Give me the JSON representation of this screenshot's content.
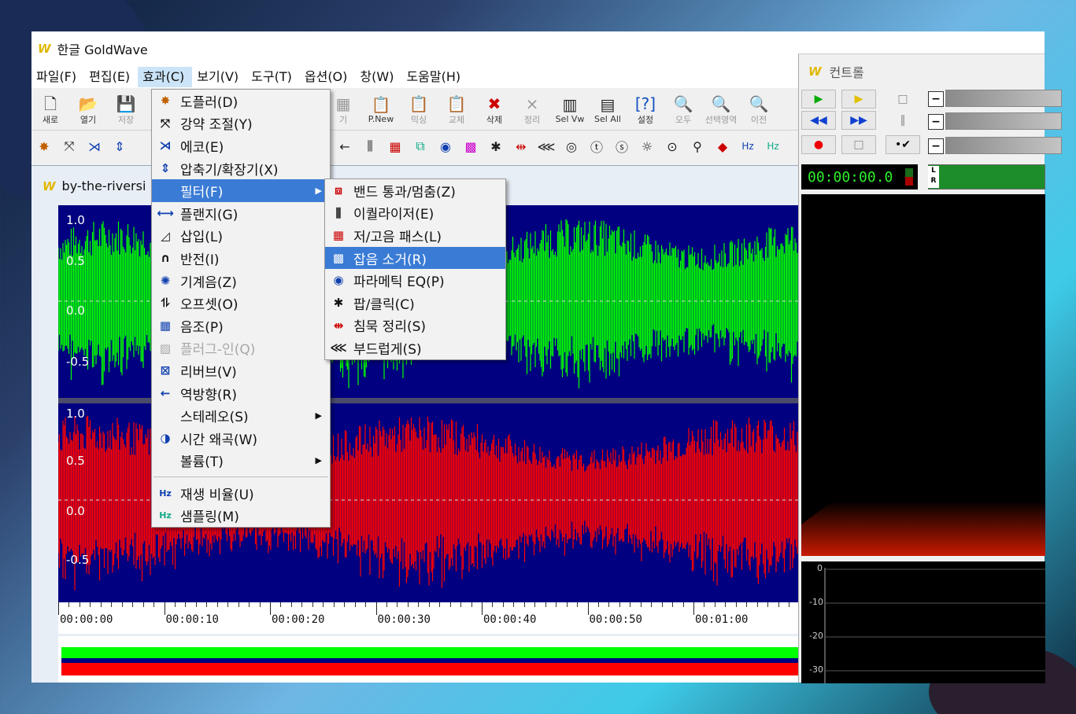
{
  "app": {
    "logo": "W",
    "title": "한글 GoldWave"
  },
  "menubar": [
    {
      "label": "파일(F)"
    },
    {
      "label": "편집(E)"
    },
    {
      "label": "효과(C)",
      "active": true
    },
    {
      "label": "보기(V)"
    },
    {
      "label": "도구(T)"
    },
    {
      "label": "옵션(O)"
    },
    {
      "label": "창(W)"
    },
    {
      "label": "도움말(H)"
    }
  ],
  "toolbar1": {
    "new": "새로",
    "open": "열기",
    "save": "저장",
    "close_hidden": "기",
    "p_new": "P.New",
    "mix": "믹싱",
    "replace": "교체",
    "delete": "삭제",
    "trim": "정리",
    "sel_view": "Sel Vw",
    "sel_all": "Sel All",
    "settings": "설정",
    "all": "오두",
    "sel_region": "선택영역",
    "prev": "이전"
  },
  "document": {
    "title": "by-the-riversi"
  },
  "axis": {
    "top_ch": [
      "1.0",
      "0.5",
      "0.0",
      "-0.5"
    ],
    "bottom_ch": [
      "1.0",
      "0.5",
      "0.0",
      "-0.5"
    ]
  },
  "ruler": [
    "00:00:00",
    "00:00:10",
    "00:00:20",
    "00:00:30",
    "00:00:40",
    "00:00:50",
    "00:01:00"
  ],
  "effects_menu": [
    {
      "label": "도플러(D)",
      "icon": "doppler-icon"
    },
    {
      "label": "강약 조절(Y)",
      "icon": "dynamics-icon"
    },
    {
      "label": "에코(E)",
      "icon": "echo-icon"
    },
    {
      "label": "압축기/확장기(X)",
      "icon": "compressor-icon"
    },
    {
      "label": "필터(F)",
      "icon": "",
      "highlight": true,
      "submenu": true
    },
    {
      "label": "플랜지(G)",
      "icon": "flanger-icon"
    },
    {
      "label": "삽입(L)",
      "icon": "fade-icon"
    },
    {
      "label": "반전(I)",
      "icon": "invert-icon"
    },
    {
      "label": "기계음(Z)",
      "icon": "mechanize-icon"
    },
    {
      "label": "오프셋(O)",
      "icon": "offset-icon"
    },
    {
      "label": "음조(P)",
      "icon": "pitch-icon"
    },
    {
      "label": "플러그-인(Q)",
      "icon": "plugin-icon",
      "disabled": true
    },
    {
      "label": "리버브(V)",
      "icon": "reverb-icon"
    },
    {
      "label": "역방향(R)",
      "icon": "reverse-icon"
    },
    {
      "label": "스테레오(S)",
      "icon": "",
      "submenu": true
    },
    {
      "label": "시간 왜곡(W)",
      "icon": "time-warp-icon"
    },
    {
      "label": "볼륨(T)",
      "icon": "",
      "submenu": true
    },
    {
      "label": "재생 비율(U)",
      "icon": "playback-rate-icon",
      "sep_before": true
    },
    {
      "label": "샘플링(M)",
      "icon": "resample-icon"
    }
  ],
  "filter_submenu": [
    {
      "label": "밴드 통과/멈춤(Z)",
      "icon": "bandpass-icon"
    },
    {
      "label": "이퀄라이저(E)",
      "icon": "equalizer-icon"
    },
    {
      "label": "저/고음 패스(L)",
      "icon": "lowhigh-pass-icon"
    },
    {
      "label": "잡음 소거(R)",
      "icon": "noise-reduction-icon",
      "highlight": true
    },
    {
      "label": "파라메틱 EQ(P)",
      "icon": "parametric-eq-icon"
    },
    {
      "label": "팝/클릭(C)",
      "icon": "pop-click-icon"
    },
    {
      "label": "침묵 정리(S)",
      "icon": "silence-reduction-icon"
    },
    {
      "label": "부드럽게(S)",
      "icon": "smoother-icon"
    }
  ],
  "control": {
    "title": "컨트롤",
    "time": "00:00:00.0",
    "lr": "L R",
    "spectrum_labels": [
      "0",
      "-10",
      "-20",
      "-30"
    ]
  },
  "colors": {
    "left_channel": "#00ff00",
    "right_channel": "#ff0000",
    "wave_bg": "#000080",
    "highlight": "#3a7bd5"
  }
}
